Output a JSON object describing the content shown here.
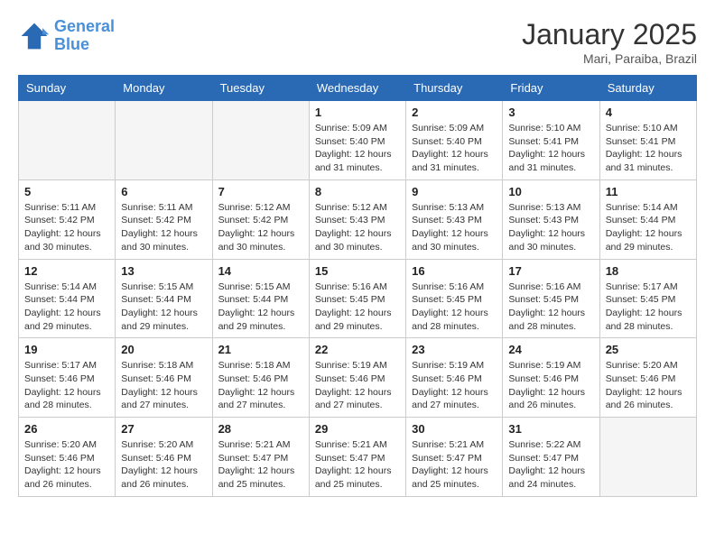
{
  "header": {
    "logo_line1": "General",
    "logo_line2": "Blue",
    "month": "January 2025",
    "location": "Mari, Paraiba, Brazil"
  },
  "weekdays": [
    "Sunday",
    "Monday",
    "Tuesday",
    "Wednesday",
    "Thursday",
    "Friday",
    "Saturday"
  ],
  "weeks": [
    [
      {
        "day": "",
        "sunrise": "",
        "sunset": "",
        "daylight": ""
      },
      {
        "day": "",
        "sunrise": "",
        "sunset": "",
        "daylight": ""
      },
      {
        "day": "",
        "sunrise": "",
        "sunset": "",
        "daylight": ""
      },
      {
        "day": "1",
        "sunrise": "Sunrise: 5:09 AM",
        "sunset": "Sunset: 5:40 PM",
        "daylight": "Daylight: 12 hours and 31 minutes."
      },
      {
        "day": "2",
        "sunrise": "Sunrise: 5:09 AM",
        "sunset": "Sunset: 5:40 PM",
        "daylight": "Daylight: 12 hours and 31 minutes."
      },
      {
        "day": "3",
        "sunrise": "Sunrise: 5:10 AM",
        "sunset": "Sunset: 5:41 PM",
        "daylight": "Daylight: 12 hours and 31 minutes."
      },
      {
        "day": "4",
        "sunrise": "Sunrise: 5:10 AM",
        "sunset": "Sunset: 5:41 PM",
        "daylight": "Daylight: 12 hours and 31 minutes."
      }
    ],
    [
      {
        "day": "5",
        "sunrise": "Sunrise: 5:11 AM",
        "sunset": "Sunset: 5:42 PM",
        "daylight": "Daylight: 12 hours and 30 minutes."
      },
      {
        "day": "6",
        "sunrise": "Sunrise: 5:11 AM",
        "sunset": "Sunset: 5:42 PM",
        "daylight": "Daylight: 12 hours and 30 minutes."
      },
      {
        "day": "7",
        "sunrise": "Sunrise: 5:12 AM",
        "sunset": "Sunset: 5:42 PM",
        "daylight": "Daylight: 12 hours and 30 minutes."
      },
      {
        "day": "8",
        "sunrise": "Sunrise: 5:12 AM",
        "sunset": "Sunset: 5:43 PM",
        "daylight": "Daylight: 12 hours and 30 minutes."
      },
      {
        "day": "9",
        "sunrise": "Sunrise: 5:13 AM",
        "sunset": "Sunset: 5:43 PM",
        "daylight": "Daylight: 12 hours and 30 minutes."
      },
      {
        "day": "10",
        "sunrise": "Sunrise: 5:13 AM",
        "sunset": "Sunset: 5:43 PM",
        "daylight": "Daylight: 12 hours and 30 minutes."
      },
      {
        "day": "11",
        "sunrise": "Sunrise: 5:14 AM",
        "sunset": "Sunset: 5:44 PM",
        "daylight": "Daylight: 12 hours and 29 minutes."
      }
    ],
    [
      {
        "day": "12",
        "sunrise": "Sunrise: 5:14 AM",
        "sunset": "Sunset: 5:44 PM",
        "daylight": "Daylight: 12 hours and 29 minutes."
      },
      {
        "day": "13",
        "sunrise": "Sunrise: 5:15 AM",
        "sunset": "Sunset: 5:44 PM",
        "daylight": "Daylight: 12 hours and 29 minutes."
      },
      {
        "day": "14",
        "sunrise": "Sunrise: 5:15 AM",
        "sunset": "Sunset: 5:44 PM",
        "daylight": "Daylight: 12 hours and 29 minutes."
      },
      {
        "day": "15",
        "sunrise": "Sunrise: 5:16 AM",
        "sunset": "Sunset: 5:45 PM",
        "daylight": "Daylight: 12 hours and 29 minutes."
      },
      {
        "day": "16",
        "sunrise": "Sunrise: 5:16 AM",
        "sunset": "Sunset: 5:45 PM",
        "daylight": "Daylight: 12 hours and 28 minutes."
      },
      {
        "day": "17",
        "sunrise": "Sunrise: 5:16 AM",
        "sunset": "Sunset: 5:45 PM",
        "daylight": "Daylight: 12 hours and 28 minutes."
      },
      {
        "day": "18",
        "sunrise": "Sunrise: 5:17 AM",
        "sunset": "Sunset: 5:45 PM",
        "daylight": "Daylight: 12 hours and 28 minutes."
      }
    ],
    [
      {
        "day": "19",
        "sunrise": "Sunrise: 5:17 AM",
        "sunset": "Sunset: 5:46 PM",
        "daylight": "Daylight: 12 hours and 28 minutes."
      },
      {
        "day": "20",
        "sunrise": "Sunrise: 5:18 AM",
        "sunset": "Sunset: 5:46 PM",
        "daylight": "Daylight: 12 hours and 27 minutes."
      },
      {
        "day": "21",
        "sunrise": "Sunrise: 5:18 AM",
        "sunset": "Sunset: 5:46 PM",
        "daylight": "Daylight: 12 hours and 27 minutes."
      },
      {
        "day": "22",
        "sunrise": "Sunrise: 5:19 AM",
        "sunset": "Sunset: 5:46 PM",
        "daylight": "Daylight: 12 hours and 27 minutes."
      },
      {
        "day": "23",
        "sunrise": "Sunrise: 5:19 AM",
        "sunset": "Sunset: 5:46 PM",
        "daylight": "Daylight: 12 hours and 27 minutes."
      },
      {
        "day": "24",
        "sunrise": "Sunrise: 5:19 AM",
        "sunset": "Sunset: 5:46 PM",
        "daylight": "Daylight: 12 hours and 26 minutes."
      },
      {
        "day": "25",
        "sunrise": "Sunrise: 5:20 AM",
        "sunset": "Sunset: 5:46 PM",
        "daylight": "Daylight: 12 hours and 26 minutes."
      }
    ],
    [
      {
        "day": "26",
        "sunrise": "Sunrise: 5:20 AM",
        "sunset": "Sunset: 5:46 PM",
        "daylight": "Daylight: 12 hours and 26 minutes."
      },
      {
        "day": "27",
        "sunrise": "Sunrise: 5:20 AM",
        "sunset": "Sunset: 5:46 PM",
        "daylight": "Daylight: 12 hours and 26 minutes."
      },
      {
        "day": "28",
        "sunrise": "Sunrise: 5:21 AM",
        "sunset": "Sunset: 5:47 PM",
        "daylight": "Daylight: 12 hours and 25 minutes."
      },
      {
        "day": "29",
        "sunrise": "Sunrise: 5:21 AM",
        "sunset": "Sunset: 5:47 PM",
        "daylight": "Daylight: 12 hours and 25 minutes."
      },
      {
        "day": "30",
        "sunrise": "Sunrise: 5:21 AM",
        "sunset": "Sunset: 5:47 PM",
        "daylight": "Daylight: 12 hours and 25 minutes."
      },
      {
        "day": "31",
        "sunrise": "Sunrise: 5:22 AM",
        "sunset": "Sunset: 5:47 PM",
        "daylight": "Daylight: 12 hours and 24 minutes."
      },
      {
        "day": "",
        "sunrise": "",
        "sunset": "",
        "daylight": ""
      }
    ]
  ]
}
